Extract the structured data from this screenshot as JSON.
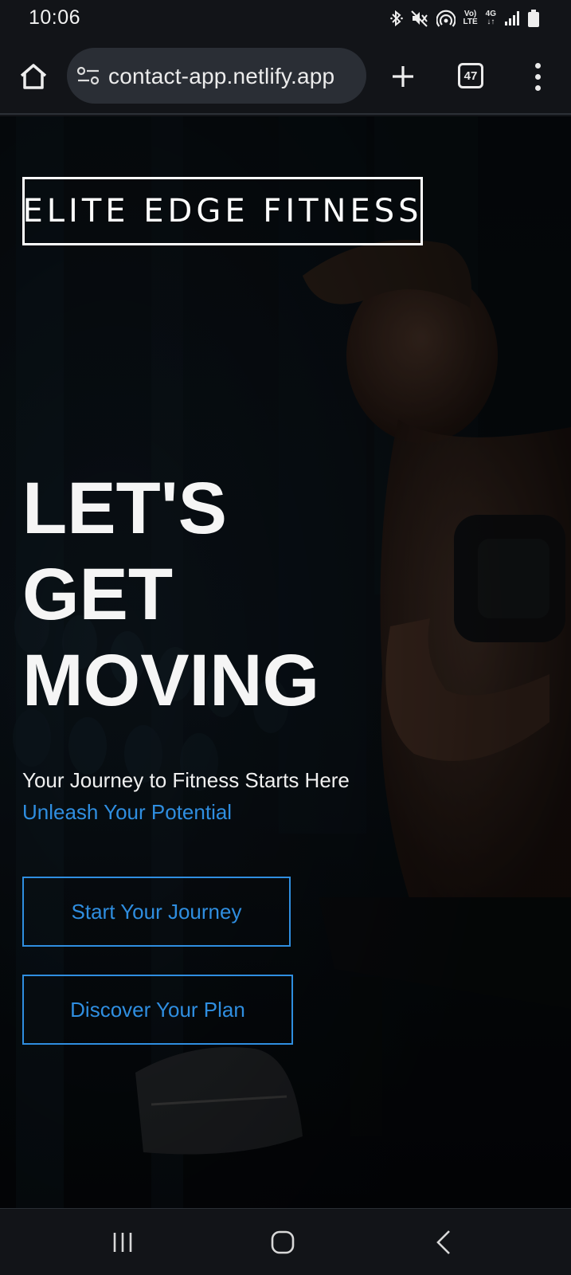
{
  "status_bar": {
    "time": "10:06",
    "icons": [
      "bluetooth-icon",
      "mute-icon",
      "hotspot-icon",
      "volte-icon",
      "4g-data-icon",
      "signal-icon",
      "battery-icon"
    ],
    "volte_top": "Vo)",
    "volte_bottom": "LTE",
    "data_top": "4G",
    "data_bottom": "↓↑"
  },
  "browser": {
    "url": "contact-app.netlify.app",
    "tab_count": "47",
    "icons": [
      "home-icon",
      "site-settings-icon",
      "plus-icon",
      "tabs-icon",
      "more-vert-icon"
    ]
  },
  "hero": {
    "logo": "ELITE EDGE FITNESS",
    "headline": [
      "LET'S",
      "GET",
      "MOVING"
    ],
    "tagline": "Your Journey to Fitness Starts Here",
    "subtagline": "Unleash Your Potential",
    "cta_primary": "Start Your Journey",
    "cta_secondary": "Discover Your Plan"
  },
  "nav_bar": {
    "icons": [
      "recent-apps-icon",
      "home-icon",
      "back-icon"
    ]
  },
  "colors": {
    "accent": "#2f8ee0",
    "background": "#121418",
    "hero_dark": "#0a1016"
  }
}
